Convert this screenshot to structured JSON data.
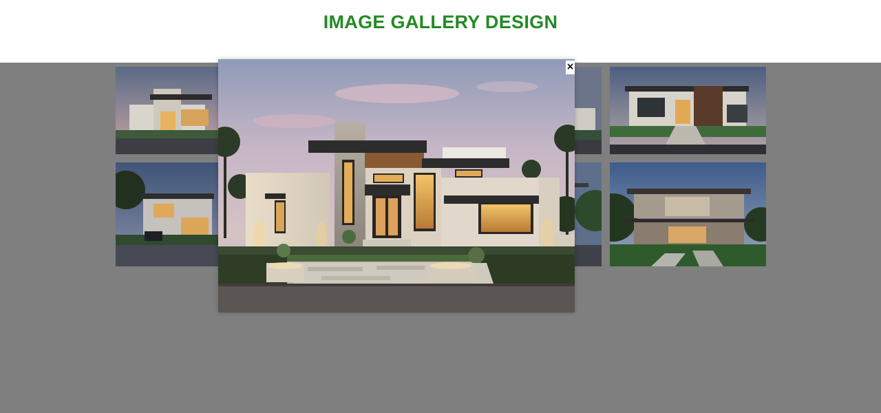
{
  "page": {
    "title": "IMAGE GALLERY DESIGN",
    "title_color": "#228b22",
    "overlay_color": "#7f7f7f"
  },
  "gallery": {
    "thumbnails": [
      {
        "name": "modern-house-1"
      },
      {
        "name": "modern-house-2"
      },
      {
        "name": "modern-house-3"
      },
      {
        "name": "modern-house-4"
      },
      {
        "name": "modern-house-5"
      },
      {
        "name": "modern-house-6"
      }
    ]
  },
  "lightbox": {
    "close_label": "×",
    "open_image": "modern-house-main"
  }
}
